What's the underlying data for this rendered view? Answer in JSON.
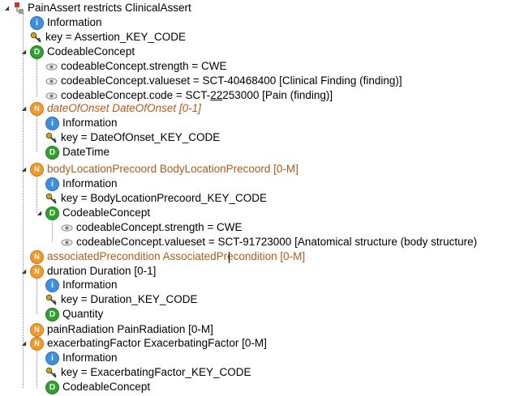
{
  "tree": {
    "root": "PainAssert restricts ClinicalAssert",
    "information": "Information",
    "key_assertion": "key = Assertion_KEY_CODE",
    "codeable_concept": "CodeableConcept",
    "cc_strength": "codeableConcept.strength = CWE",
    "cc_valueset": "codeableConcept.valueset = SCT-40468400 [Clinical Finding (finding)]",
    "cc_code_prefix": "codeableConcept.code = SCT-",
    "cc_code_underlined": "22",
    "cc_code_suffix": "253000 [Pain (finding)]",
    "date_of_onset": "dateOfOnset DateOfOnset [0-1]",
    "key_date_of_onset": "key = DateOfOnset_KEY_CODE",
    "date_time": "DateTime",
    "body_location": "bodyLocationPrecoord BodyLocationPrecoord [0-M]",
    "key_body_location": "key = BodyLocationPrecoord_KEY_CODE",
    "bl_strength": "codeableConcept.strength = CWE",
    "bl_valueset": "codeableConcept.valueset = SCT-91723000 [Anatomical structure (body structure)",
    "associated_precondition": "associatedPrecondition AssociatedPrecondition [0-M]",
    "duration": "duration Duration [0-1]",
    "key_duration": "key = Duration_KEY_CODE",
    "quantity": "Quantity",
    "pain_radiation": "painRadiation PainRadiation [0-M]",
    "exacerbating_factor": "exacerbatingFactor ExacerbatingFactor [0-M]",
    "key_exacerbating": "key = ExacerbatingFactor_KEY_CODE"
  },
  "icons": {
    "info": "i",
    "data": "D",
    "node": "N"
  }
}
